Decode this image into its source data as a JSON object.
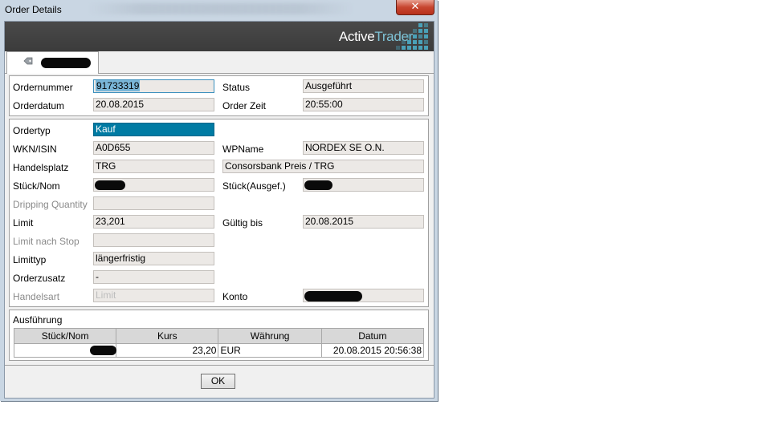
{
  "window": {
    "title": "Order Details",
    "close_glyph": "✕"
  },
  "brand": {
    "part1": "Active",
    "part2": "Trader"
  },
  "colors": {
    "accent": "#007ba3",
    "banner": "#3b3b3b",
    "brand_teal": "#4aa1b8"
  },
  "tab": {
    "icon": "tag-icon"
  },
  "header": {
    "order_number_label": "Ordernummer",
    "order_number": "91733319",
    "status_label": "Status",
    "status": "Ausgeführt",
    "order_date_label": "Orderdatum",
    "order_date": "20.08.2015",
    "order_time_label": "Order Zeit",
    "order_time": "20:55:00"
  },
  "details": {
    "order_type_label": "Ordertyp",
    "order_type": "Kauf",
    "wkn_label": "WKN/ISIN",
    "wkn": "A0D655",
    "wpname_label": "WPName",
    "wpname": "NORDEX SE O.N.",
    "venue_label": "Handelsplatz",
    "venue": "TRG",
    "venue_name": "Consorsbank Preis / TRG",
    "qty_label": "Stück/Nom",
    "qty_exec_label": "Stück(Ausgef.)",
    "dripping_label": "Dripping Quantity",
    "limit_label": "Limit",
    "limit": "23,201",
    "valid_label": "Gültig bis",
    "valid": "20.08.2015",
    "stop_label": "Limit nach Stop",
    "limittype_label": "Limittyp",
    "limittype": "längerfristig",
    "addon_label": "Orderzusatz",
    "addon": "-",
    "tradetype_label": "Handelsart",
    "tradetype": "Limit",
    "account_label": "Konto"
  },
  "execution": {
    "title": "Ausführung",
    "columns": [
      "Stück/Nom",
      "Kurs",
      "Währung",
      "Datum"
    ],
    "row": {
      "kurs": "23,20",
      "waehrung": "EUR",
      "datum": "20.08.2015 20:56:38"
    }
  },
  "ok_label": "OK"
}
